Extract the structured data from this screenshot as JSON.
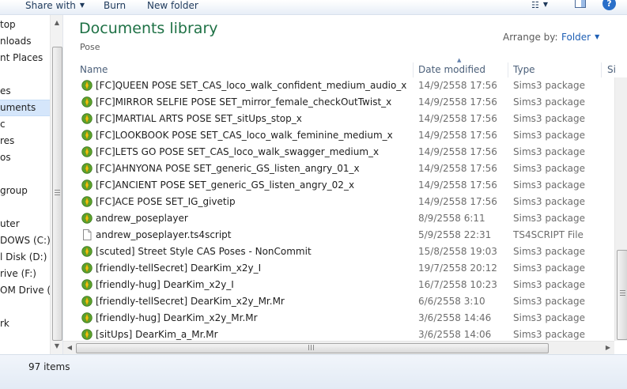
{
  "toolbar": {
    "share_with": "Share with",
    "burn": "Burn",
    "new_folder": "New folder"
  },
  "nav": {
    "items": [
      {
        "label": "top",
        "selected": false
      },
      {
        "label": "nloads",
        "selected": false
      },
      {
        "label": "nt Places",
        "selected": false
      },
      {
        "label": "es",
        "selected": false
      },
      {
        "label": "uments",
        "selected": true
      },
      {
        "label": "c",
        "selected": false
      },
      {
        "label": "res",
        "selected": false
      },
      {
        "label": "os",
        "selected": false
      },
      {
        "label": "group",
        "selected": false
      },
      {
        "label": "uter",
        "selected": false
      },
      {
        "label": "DOWS (C:)",
        "selected": false
      },
      {
        "label": "l Disk (D:)",
        "selected": false
      },
      {
        "label": "rive (F:)",
        "selected": false
      },
      {
        "label": "OM Drive (G",
        "selected": false
      },
      {
        "label": "rk",
        "selected": false
      }
    ]
  },
  "library": {
    "title": "Documents library",
    "subtitle": "Pose",
    "arrange_label": "Arrange by:",
    "arrange_value": "Folder"
  },
  "columns": {
    "name": "Name",
    "date": "Date modified",
    "type": "Type",
    "size": "Si"
  },
  "files": [
    {
      "name": "[FC]QUEEN POSE SET_CAS_loco_walk_confident_medium_audio_x",
      "date": "14/9/2558 17:56",
      "type": "Sims3 package",
      "icon": "sims-package-icon"
    },
    {
      "name": "[FC]MIRROR SELFIE POSE SET_mirror_female_checkOutTwist_x",
      "date": "14/9/2558 17:56",
      "type": "Sims3 package",
      "icon": "sims-package-icon"
    },
    {
      "name": "[FC]MARTIAL ARTS POSE SET_sitUps_stop_x",
      "date": "14/9/2558 17:56",
      "type": "Sims3 package",
      "icon": "sims-package-icon"
    },
    {
      "name": "[FC]LOOKBOOK POSE SET_CAS_loco_walk_feminine_medium_x",
      "date": "14/9/2558 17:56",
      "type": "Sims3 package",
      "icon": "sims-package-icon"
    },
    {
      "name": "[FC]LETS GO POSE SET_CAS_loco_walk_swagger_medium_x",
      "date": "14/9/2558 17:56",
      "type": "Sims3 package",
      "icon": "sims-package-icon"
    },
    {
      "name": "[FC]AHNYONA POSE SET_generic_GS_listen_angry_01_x",
      "date": "14/9/2558 17:56",
      "type": "Sims3 package",
      "icon": "sims-package-icon"
    },
    {
      "name": "[FC]ANCIENT POSE SET_generic_GS_listen_angry_02_x",
      "date": "14/9/2558 17:56",
      "type": "Sims3 package",
      "icon": "sims-package-icon"
    },
    {
      "name": "[FC]ACE POSE SET_IG_givetip",
      "date": "14/9/2558 17:56",
      "type": "Sims3 package",
      "icon": "sims-package-icon"
    },
    {
      "name": "andrew_poseplayer",
      "date": "8/9/2558 6:11",
      "type": "Sims3 package",
      "icon": "sims-package-icon"
    },
    {
      "name": "andrew_poseplayer.ts4script",
      "date": "5/9/2558 22:31",
      "type": "TS4SCRIPT File",
      "icon": "blank-file-icon"
    },
    {
      "name": "[scuted] Street Style CAS Poses - NonCommit",
      "date": "15/8/2558 19:03",
      "type": "Sims3 package",
      "icon": "sims-package-icon"
    },
    {
      "name": "[friendly-tellSecret] DearKim_x2y_I",
      "date": "19/7/2558 20:12",
      "type": "Sims3 package",
      "icon": "sims-package-icon"
    },
    {
      "name": "[friendly-hug] DearKim_x2y_I",
      "date": "16/7/2558 10:23",
      "type": "Sims3 package",
      "icon": "sims-package-icon"
    },
    {
      "name": "[friendly-tellSecret] DearKim_x2y_Mr.Mr",
      "date": "6/6/2558 3:10",
      "type": "Sims3 package",
      "icon": "sims-package-icon"
    },
    {
      "name": "[friendly-hug] DearKim_x2y_Mr.Mr",
      "date": "3/6/2558 14:46",
      "type": "Sims3 package",
      "icon": "sims-package-icon"
    },
    {
      "name": "[sitUps] DearKim_a_Mr.Mr",
      "date": "3/6/2558 14:06",
      "type": "Sims3 package",
      "icon": "sims-package-icon"
    }
  ],
  "status": {
    "item_count": "97 items"
  },
  "colors": {
    "title": "#1e7145",
    "link": "#1e5fb4",
    "selection": "#d5e6fb",
    "sims_icon_green": "#5ca22e",
    "sims_icon_yellow": "#f1c40f"
  }
}
